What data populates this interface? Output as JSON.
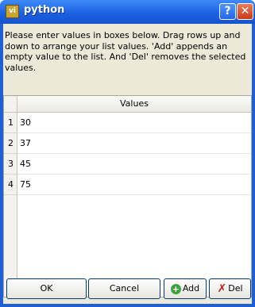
{
  "window": {
    "title": "python",
    "icon_glyph": "vi",
    "help_glyph": "?",
    "close_glyph": "✕"
  },
  "description": "Please enter values in boxes below. Drag rows up and down to arrange your list values. 'Add' appends an empty value to the list. And 'Del' removes the selected values.",
  "table": {
    "column_header": "Values",
    "rows": [
      {
        "num": "1",
        "value": "30"
      },
      {
        "num": "2",
        "value": "37"
      },
      {
        "num": "3",
        "value": "45"
      },
      {
        "num": "4",
        "value": "75"
      }
    ]
  },
  "buttons": {
    "ok": "OK",
    "cancel": "Cancel",
    "add": "Add",
    "del": "Del"
  },
  "icons": {
    "add": "add-icon",
    "del": "delete-icon"
  }
}
